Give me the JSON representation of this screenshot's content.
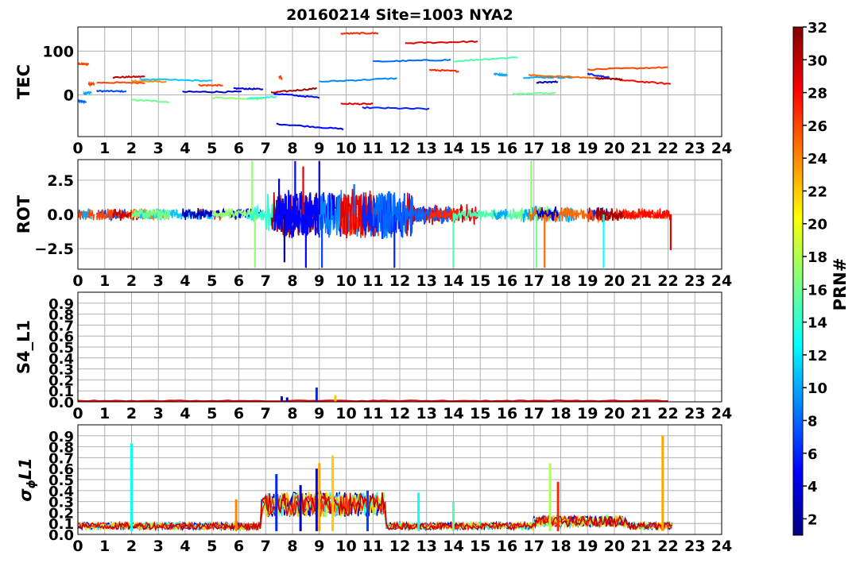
{
  "title": "20160214 Site=1003 NYA2",
  "xticks": [
    "0",
    "1",
    "2",
    "3",
    "4",
    "5",
    "6",
    "7",
    "8",
    "9",
    "10",
    "11",
    "12",
    "13",
    "14",
    "15",
    "16",
    "17",
    "18",
    "19",
    "20",
    "21",
    "22",
    "23",
    "24"
  ],
  "panels": [
    {
      "id": "tec",
      "ylabel": "TEC",
      "yticks": [
        "0",
        "100"
      ],
      "ylim": [
        -95,
        155
      ]
    },
    {
      "id": "rot",
      "ylabel": "ROT",
      "yticks": [
        "−2.5",
        "0.0",
        "2.5"
      ],
      "ylim": [
        -4,
        4
      ]
    },
    {
      "id": "s4",
      "ylabel": "S4_L1",
      "yticks": [
        "0.0",
        "0.1",
        "0.2",
        "0.3",
        "0.4",
        "0.5",
        "0.6",
        "0.7",
        "0.8",
        "0.9"
      ],
      "ylim": [
        0,
        1
      ]
    },
    {
      "id": "sigma",
      "ylabel_main": "σ",
      "ylabel_sub": "ϕ",
      "ylabel_rest": "L1",
      "yticks": [
        "0.0",
        "0.1",
        "0.2",
        "0.3",
        "0.4",
        "0.5",
        "0.6",
        "0.7",
        "0.8",
        "0.9"
      ],
      "ylim": [
        0,
        1
      ]
    }
  ],
  "colorbar": {
    "label": "PRN#",
    "range": [
      1,
      32
    ],
    "ticks": [
      "2",
      "4",
      "6",
      "8",
      "10",
      "12",
      "14",
      "16",
      "18",
      "20",
      "22",
      "24",
      "26",
      "28",
      "30",
      "32"
    ],
    "colormap": "jet"
  },
  "chart_data": [
    {
      "type": "line",
      "panel": "TEC",
      "xlim": [
        0,
        24
      ],
      "ylim": [
        -95,
        155
      ],
      "grid": true,
      "series": [
        {
          "prn": 8,
          "x": [
            0.0,
            0.3
          ],
          "y": [
            -14,
            -16
          ]
        },
        {
          "prn": 26,
          "x": [
            0.0,
            0.4
          ],
          "y": [
            71,
            70
          ]
        },
        {
          "prn": 10,
          "x": [
            0.2,
            0.5
          ],
          "y": [
            3,
            6
          ]
        },
        {
          "prn": 7,
          "x": [
            0.7,
            1.8
          ],
          "y": [
            9,
            8
          ]
        },
        {
          "prn": 26,
          "x": [
            0.4,
            0.6
          ],
          "y": [
            24,
            26
          ]
        },
        {
          "prn": 26,
          "x": [
            0.7,
            2.5
          ],
          "y": [
            28,
            28
          ]
        },
        {
          "prn": 30,
          "x": [
            1.3,
            2.5
          ],
          "y": [
            40,
            42
          ]
        },
        {
          "prn": 24,
          "x": [
            2.0,
            3.3
          ],
          "y": [
            32,
            30
          ]
        },
        {
          "prn": 11,
          "x": [
            2.3,
            5.0
          ],
          "y": [
            36,
            32
          ]
        },
        {
          "prn": 16,
          "x": [
            2.0,
            3.4
          ],
          "y": [
            -11,
            -16
          ]
        },
        {
          "prn": 26,
          "x": [
            4.5,
            5.4
          ],
          "y": [
            22,
            22
          ]
        },
        {
          "prn": 3,
          "x": [
            3.9,
            6.1
          ],
          "y": [
            7,
            7
          ]
        },
        {
          "prn": 4,
          "x": [
            5.8,
            6.9
          ],
          "y": [
            15,
            13
          ]
        },
        {
          "prn": 17,
          "x": [
            5.0,
            6.9
          ],
          "y": [
            -6,
            -9
          ]
        },
        {
          "prn": 14,
          "x": [
            6.3,
            7.4
          ],
          "y": [
            -8,
            -4
          ]
        },
        {
          "prn": 26,
          "x": [
            7.5,
            7.6
          ],
          "y": [
            42,
            38
          ]
        },
        {
          "prn": 31,
          "x": [
            7.2,
            8.9
          ],
          "y": [
            5,
            15
          ]
        },
        {
          "prn": 5,
          "x": [
            7.3,
            9.0
          ],
          "y": [
            3,
            -6
          ]
        },
        {
          "prn": 5,
          "x": [
            7.4,
            9.9
          ],
          "y": [
            -66,
            -78
          ]
        },
        {
          "prn": 9,
          "x": [
            9.0,
            11.9
          ],
          "y": [
            30,
            38
          ]
        },
        {
          "prn": 27,
          "x": [
            9.8,
            11.2
          ],
          "y": [
            140,
            141
          ]
        },
        {
          "prn": 29,
          "x": [
            9.8,
            11.0
          ],
          "y": [
            -20,
            -21
          ]
        },
        {
          "prn": 6,
          "x": [
            10.6,
            13.1
          ],
          "y": [
            -29,
            -32
          ]
        },
        {
          "prn": 29,
          "x": [
            12.2,
            14.9
          ],
          "y": [
            118,
            122
          ]
        },
        {
          "prn": 8,
          "x": [
            11.0,
            13.9
          ],
          "y": [
            76,
            80
          ]
        },
        {
          "prn": 27,
          "x": [
            13.1,
            14.2
          ],
          "y": [
            57,
            54
          ]
        },
        {
          "prn": 15,
          "x": [
            14.0,
            16.4
          ],
          "y": [
            77,
            86
          ]
        },
        {
          "prn": 10,
          "x": [
            15.5,
            16.0
          ],
          "y": [
            48,
            45
          ]
        },
        {
          "prn": 16,
          "x": [
            16.2,
            17.8
          ],
          "y": [
            2,
            5
          ]
        },
        {
          "prn": 10,
          "x": [
            16.6,
            18.5
          ],
          "y": [
            40,
            40
          ]
        },
        {
          "prn": 25,
          "x": [
            16.8,
            19.6
          ],
          "y": [
            45,
            38
          ]
        },
        {
          "prn": 3,
          "x": [
            17.1,
            17.9
          ],
          "y": [
            28,
            30
          ]
        },
        {
          "prn": 6,
          "x": [
            19.0,
            19.8
          ],
          "y": [
            48,
            40
          ]
        },
        {
          "prn": 26,
          "x": [
            19.0,
            22.0
          ],
          "y": [
            58,
            63
          ]
        },
        {
          "prn": 28,
          "x": [
            20.0,
            22.1
          ],
          "y": [
            35,
            25
          ]
        },
        {
          "prn": 31,
          "x": [
            19.3,
            20.3
          ],
          "y": [
            38,
            36
          ]
        }
      ]
    },
    {
      "type": "line",
      "panel": "ROT",
      "xlim": [
        0,
        24
      ],
      "ylim": [
        -4,
        4
      ],
      "grid": true,
      "spikes": [
        {
          "prn": 17,
          "x": 6.5,
          "y": 3.9
        },
        {
          "prn": 17,
          "x": 6.6,
          "y": -3.9
        },
        {
          "prn": 3,
          "x": 7.5,
          "y": 2.6
        },
        {
          "prn": 3,
          "x": 7.7,
          "y": -3.5
        },
        {
          "prn": 5,
          "x": 8.1,
          "y": 3.9
        },
        {
          "prn": 29,
          "x": 8.4,
          "y": 3.5
        },
        {
          "prn": 5,
          "x": 8.5,
          "y": -3.9
        },
        {
          "prn": 4,
          "x": 9.0,
          "y": 3.9
        },
        {
          "prn": 7,
          "x": 9.1,
          "y": -3.9
        },
        {
          "prn": 8,
          "x": 10.3,
          "y": 2.2
        },
        {
          "prn": 6,
          "x": 11.8,
          "y": -3.9
        },
        {
          "prn": 15,
          "x": 14.0,
          "y": -3.9
        },
        {
          "prn": 17,
          "x": 16.9,
          "y": 3.9
        },
        {
          "prn": 16,
          "x": 17.1,
          "y": -3.9
        },
        {
          "prn": 25,
          "x": 17.4,
          "y": -3.9
        },
        {
          "prn": 13,
          "x": 19.6,
          "y": -3.9
        },
        {
          "prn": 29,
          "x": 22.1,
          "y": -2.6
        }
      ]
    },
    {
      "type": "bar",
      "panel": "S4_L1",
      "xlim": [
        0,
        24
      ],
      "ylim": [
        0,
        1
      ],
      "grid": true,
      "peaks": [
        {
          "prn": 5,
          "x": 7.6,
          "y": 0.05
        },
        {
          "prn": 3,
          "x": 7.8,
          "y": 0.04
        },
        {
          "prn": 6,
          "x": 8.9,
          "y": 0.13
        },
        {
          "prn": 22,
          "x": 9.6,
          "y": 0.06
        }
      ]
    },
    {
      "type": "line",
      "panel": "sigma_phi_L1",
      "xlim": [
        0,
        24
      ],
      "ylim": [
        0,
        1
      ],
      "grid": true,
      "peaks": [
        {
          "prn": 13,
          "x": 2.0,
          "y": 0.83
        },
        {
          "prn": 24,
          "x": 5.9,
          "y": 0.32
        },
        {
          "prn": 6,
          "x": 7.4,
          "y": 0.55
        },
        {
          "prn": 3,
          "x": 8.3,
          "y": 0.45
        },
        {
          "prn": 5,
          "x": 8.9,
          "y": 0.6
        },
        {
          "prn": 23,
          "x": 9.0,
          "y": 0.65
        },
        {
          "prn": 22,
          "x": 9.5,
          "y": 0.72
        },
        {
          "prn": 7,
          "x": 10.8,
          "y": 0.4
        },
        {
          "prn": 13,
          "x": 12.7,
          "y": 0.38
        },
        {
          "prn": 15,
          "x": 14.0,
          "y": 0.3
        },
        {
          "prn": 18,
          "x": 17.6,
          "y": 0.65
        },
        {
          "prn": 27,
          "x": 17.9,
          "y": 0.48
        },
        {
          "prn": 23,
          "x": 21.8,
          "y": 0.9
        }
      ]
    }
  ]
}
